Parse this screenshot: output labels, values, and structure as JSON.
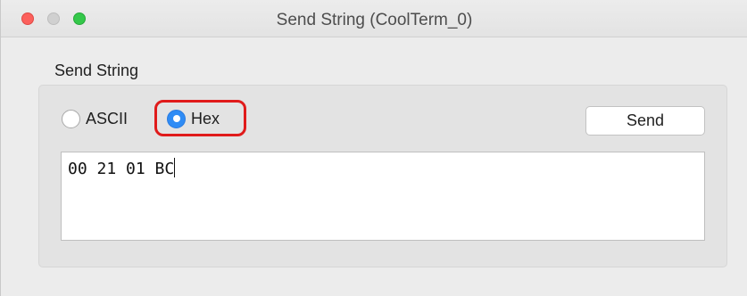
{
  "window": {
    "title": "Send String (CoolTerm_0)"
  },
  "group": {
    "label": "Send String"
  },
  "mode": {
    "options": [
      {
        "label": "ASCII",
        "selected": false
      },
      {
        "label": "Hex",
        "selected": true
      }
    ]
  },
  "send_button": {
    "label": "Send"
  },
  "input": {
    "value": "00 21 01 BC"
  },
  "colors": {
    "highlight": "#e01b1b",
    "radio_selected": "#2f8cf5"
  }
}
